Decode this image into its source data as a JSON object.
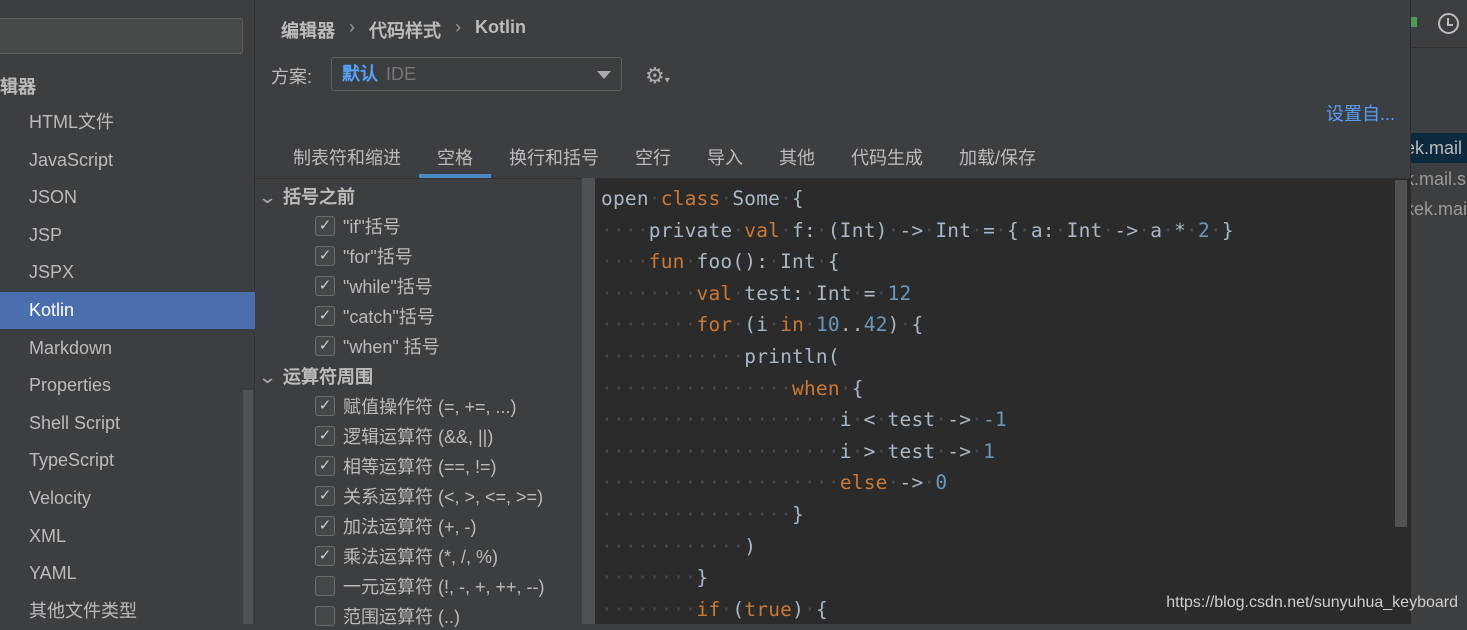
{
  "sidebar": {
    "title": "辑器",
    "items": [
      "HTML文件",
      "JavaScript",
      "JSON",
      "JSP",
      "JSPX",
      "Kotlin",
      "Markdown",
      "Properties",
      "Shell Script",
      "TypeScript",
      "Velocity",
      "XML",
      "YAML",
      "其他文件类型"
    ],
    "selected": "Kotlin"
  },
  "breadcrumb": [
    "编辑器",
    "代码样式",
    "Kotlin"
  ],
  "scheme": {
    "label": "方案:",
    "name": "默认",
    "type": "IDE"
  },
  "set_from": "设置自...",
  "tabs": [
    "制表符和缩进",
    "空格",
    "换行和括号",
    "空行",
    "导入",
    "其他",
    "代码生成",
    "加载/保存"
  ],
  "selected_tab": "空格",
  "groups": [
    {
      "title": "括号之前",
      "options": [
        {
          "label": "\"if\"括号",
          "checked": true
        },
        {
          "label": "\"for\"括号",
          "checked": true
        },
        {
          "label": "\"while\"括号",
          "checked": true
        },
        {
          "label": "\"catch\"括号",
          "checked": true
        },
        {
          "label": "\"when\" 括号",
          "checked": true
        }
      ]
    },
    {
      "title": "运算符周围",
      "options": [
        {
          "label": "赋值操作符 (=, +=, ...)",
          "checked": true
        },
        {
          "label": "逻辑运算符 (&&, ||)",
          "checked": true
        },
        {
          "label": "相等运算符 (==, !=)",
          "checked": true
        },
        {
          "label": "关系运算符 (<, >, <=, >=)",
          "checked": true
        },
        {
          "label": "加法运算符 (+, -)",
          "checked": true
        },
        {
          "label": "乘法运算符 (*, /, %)",
          "checked": true
        },
        {
          "label": "一元运算符 (!, -, +, ++, --)",
          "checked": false
        },
        {
          "label": "范围运算符 (..)",
          "checked": false
        }
      ]
    }
  ],
  "code": [
    [
      [
        "t",
        "open "
      ],
      [
        "k",
        "class"
      ],
      [
        "t",
        " Some {"
      ]
    ],
    [
      [
        "t",
        "    private "
      ],
      [
        "k",
        "val"
      ],
      [
        "t",
        " f: (Int) -> Int = { a: Int -> a * "
      ],
      [
        "n",
        "2"
      ],
      [
        "t",
        " }"
      ]
    ],
    [
      [
        "t",
        "    "
      ],
      [
        "k",
        "fun"
      ],
      [
        "t",
        " foo(): Int {"
      ]
    ],
    [
      [
        "t",
        "        "
      ],
      [
        "k",
        "val"
      ],
      [
        "t",
        " test: Int = "
      ],
      [
        "n",
        "12"
      ]
    ],
    [
      [
        "t",
        "        "
      ],
      [
        "k",
        "for"
      ],
      [
        "t",
        " (i "
      ],
      [
        "k",
        "in"
      ],
      [
        "t",
        " "
      ],
      [
        "n",
        "10"
      ],
      [
        "t",
        ".."
      ],
      [
        "n",
        "42"
      ],
      [
        "t",
        ") {"
      ]
    ],
    [
      [
        "t",
        "            println("
      ]
    ],
    [
      [
        "t",
        "                "
      ],
      [
        "k",
        "when"
      ],
      [
        "t",
        " {"
      ]
    ],
    [
      [
        "t",
        "                    i < test -> "
      ],
      [
        "n",
        "-1"
      ]
    ],
    [
      [
        "t",
        "                    i > test -> "
      ],
      [
        "n",
        "1"
      ]
    ],
    [
      [
        "t",
        "                    "
      ],
      [
        "k",
        "else"
      ],
      [
        "t",
        " -> "
      ],
      [
        "n",
        "0"
      ]
    ],
    [
      [
        "t",
        "                }"
      ]
    ],
    [
      [
        "t",
        "            )"
      ]
    ],
    [
      [
        "t",
        "        }"
      ]
    ],
    [
      [
        "t",
        "        "
      ],
      [
        "k",
        "if"
      ],
      [
        "t",
        " ("
      ],
      [
        "k",
        "true"
      ],
      [
        "t",
        ") {"
      ]
    ]
  ],
  "right_panel": {
    "rows": [
      "ek.mail",
      "k.mail.s",
      "kek.mai"
    ]
  },
  "watermark": "https://blog.csdn.net/sunyuhua_keyboard",
  "colors": {
    "accent": "#4b6eaf",
    "link": "#589df6",
    "keyword": "#cc7832",
    "number": "#6897bb",
    "text": "#a9b7c6"
  }
}
